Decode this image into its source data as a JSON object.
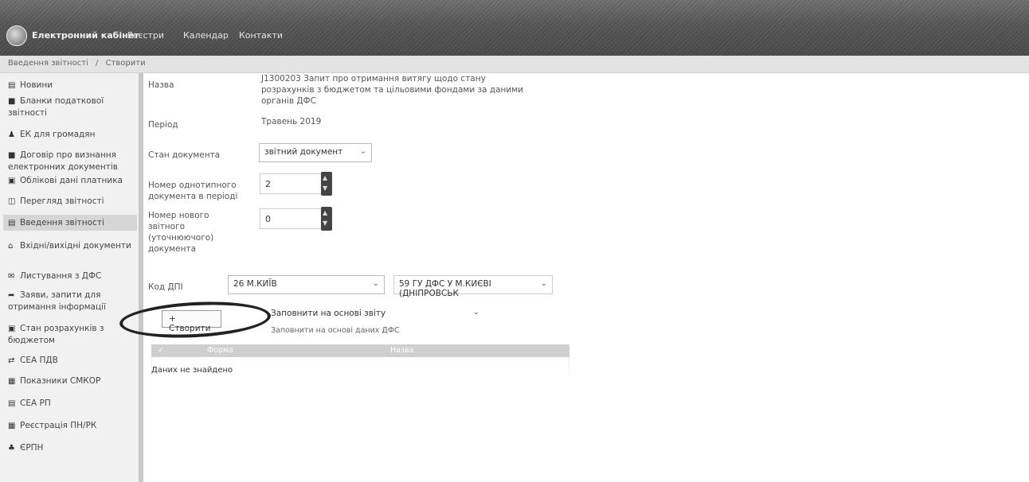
{
  "header": {
    "brand": "Електронний кабінет",
    "nav": [
      "Реєстри",
      "Календар",
      "Контакти"
    ]
  },
  "breadcrumb": [
    "Введення звітності",
    "/",
    "Створити"
  ],
  "sidebar": {
    "items": [
      {
        "icon": "news-icon",
        "label": "Новини"
      },
      {
        "icon": "forms-icon",
        "label": "Бланки податкової звітності"
      },
      {
        "icon": "user-icon",
        "label": "ЕК для громадян"
      },
      {
        "icon": "contract-icon",
        "label": "Договір про визнання електронних документів"
      },
      {
        "icon": "card-icon",
        "label": "Облікові дані платника"
      },
      {
        "icon": "view-icon",
        "label": "Перегляд звітності"
      },
      {
        "icon": "input-icon",
        "label": "Введення звітності"
      },
      {
        "icon": "inbox-icon",
        "label": "Вхідні/вихідні документи"
      },
      {
        "icon": "mail-icon",
        "label": "Листування з ДФС"
      },
      {
        "icon": "share-icon",
        "label": "Заяви, запити для отримання інформації"
      },
      {
        "icon": "balance-icon",
        "label": "Стан розрахунків з бюджетом"
      },
      {
        "icon": "exchange-icon",
        "label": "СЕА ПДВ"
      },
      {
        "icon": "grid-icon",
        "label": "Показники СМКОР"
      },
      {
        "icon": "table-icon",
        "label": "СЕА РП"
      },
      {
        "icon": "register-icon",
        "label": "Реєстрація ПН/РК"
      },
      {
        "icon": "people-icon",
        "label": "ЄРПН"
      }
    ]
  },
  "form": {
    "name_label": "Назва",
    "name_value": "J1300203 Запит про отримання витягу щодо стану розрахунків з бюджетом та цільовими фондами за даними органів ДФС",
    "period_label": "Період",
    "period_value": "Травень 2019",
    "doc_state_label": "Стан документа",
    "doc_state_value": "звітний документ",
    "same_doc_label": "Номер однотипного документа в періоді",
    "same_doc_value": "2",
    "new_doc_label": "Номер нового звітного (уточнюючого) документа",
    "new_doc_value": "0",
    "dpi_label": "Код ДПІ",
    "dpi_region": "26 М.КИЇВ",
    "dpi_office": "59 ГУ ДФС У М.КИЄВІ (ДНІПРОВСЬК",
    "create_button": "+ Створити",
    "fill_select": "Заповнити на основі звіту",
    "fill_link": "Заповнити на основі даних ДФС"
  },
  "table": {
    "columns": [
      "✓",
      "Форма",
      "Назва"
    ],
    "empty_text": "Даних не знайдено"
  }
}
